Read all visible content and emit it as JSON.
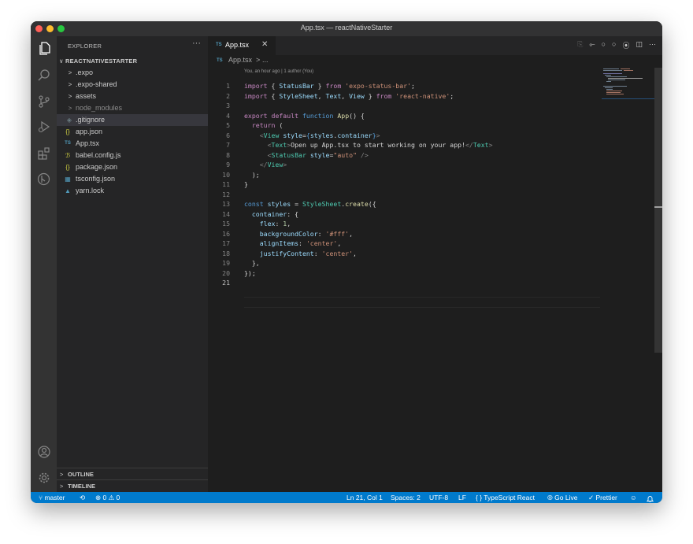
{
  "window": {
    "title": "App.tsx — reactNativeStarter"
  },
  "colors": {
    "accent": "#007acc",
    "editor_bg": "#1e1e1e",
    "sidebar_bg": "#252526",
    "activity_bg": "#333333"
  },
  "activity_bar": {
    "top": [
      "files-icon",
      "search-icon",
      "source-control-icon",
      "run-debug-icon",
      "extensions-icon",
      "gitlens-icon"
    ],
    "bottom": [
      "account-icon",
      "settings-gear-icon"
    ]
  },
  "sidebar": {
    "header": "EXPLORER",
    "more": "···",
    "section": "REACTNATIVESTARTER",
    "items": [
      {
        "icon": ">",
        "label": ".expo"
      },
      {
        "icon": ">",
        "label": ".expo-shared"
      },
      {
        "icon": ">",
        "label": "assets"
      },
      {
        "icon": ">",
        "label": "node_modules"
      },
      {
        "icon": "◈",
        "label": ".gitignore"
      },
      {
        "icon": "{}",
        "label": "app.json"
      },
      {
        "icon": "TS",
        "label": "App.tsx"
      },
      {
        "icon": "ℬ",
        "label": "babel.config.js"
      },
      {
        "icon": "{}",
        "label": "package.json"
      },
      {
        "icon": "▦",
        "label": "tsconfig.json"
      },
      {
        "icon": "▲",
        "label": "yarn.lock"
      }
    ],
    "outline": "OUTLINE",
    "timeline": "TIMELINE"
  },
  "tab": {
    "lang": "TS",
    "name": "App.tsx",
    "close": "✕"
  },
  "tab_actions": [
    "⎘",
    "⟜",
    "○",
    "○",
    "⦿",
    "◫",
    "···"
  ],
  "breadcrumb": {
    "lang": "TS",
    "file": "App.tsx",
    "sep": ">",
    "rest": "..."
  },
  "editor": {
    "blame": "You, an hour ago | 1 author (You)",
    "current_line": 21,
    "lines": [
      "1",
      "2",
      "3",
      "4",
      "5",
      "6",
      "7",
      "8",
      "9",
      "10",
      "11",
      "12",
      "13",
      "14",
      "15",
      "16",
      "17",
      "18",
      "19",
      "20",
      "21"
    ],
    "code": {
      "l1": [
        "import",
        " { ",
        "StatusBar",
        " } ",
        "from",
        " ",
        "'expo-status-bar'",
        ";"
      ],
      "l2": [
        "import",
        " { ",
        "StyleSheet",
        ", ",
        "Text",
        ", ",
        "View",
        " } ",
        "from",
        " ",
        "'react-native'",
        ";"
      ],
      "l4": [
        "export",
        " ",
        "default",
        " ",
        "function",
        " ",
        "App",
        "() {"
      ],
      "l5": [
        "  ",
        "return",
        " ("
      ],
      "l6": [
        "    <",
        "View",
        " ",
        "style",
        "=",
        "{",
        "styles",
        ".",
        "container",
        "}",
        ">"
      ],
      "l7": [
        "      <",
        "Text",
        ">",
        "Open up App.tsx to start working on your app!",
        "</",
        "Text",
        ">"
      ],
      "l8": [
        "      <",
        "StatusBar",
        " ",
        "style",
        "=",
        "\"auto\"",
        " />"
      ],
      "l9": [
        "    </",
        "View",
        ">"
      ],
      "l10": [
        "  );"
      ],
      "l11": [
        "}"
      ],
      "l13": [
        "const",
        " ",
        "styles",
        " = ",
        "StyleSheet",
        ".",
        "create",
        "({"
      ],
      "l14": [
        "  ",
        "container",
        ": {"
      ],
      "l15": [
        "    ",
        "flex",
        ": ",
        "1",
        ","
      ],
      "l16": [
        "    ",
        "backgroundColor",
        ": ",
        "'#fff'",
        ","
      ],
      "l17": [
        "    ",
        "alignItems",
        ": ",
        "'center'",
        ","
      ],
      "l18": [
        "    ",
        "justifyContent",
        ": ",
        "'center'",
        ","
      ],
      "l19": [
        "  },"
      ],
      "l20": [
        "});"
      ]
    }
  },
  "status": {
    "branch": "master",
    "sync": "⟲",
    "problems": "⊗ 0 ⚠ 0",
    "position": "Ln 21, Col 1",
    "spaces": "Spaces: 2",
    "encoding": "UTF-8",
    "eol": "LF",
    "language": "{ } TypeScript React",
    "golive": "⦾ Go Live",
    "prettier": "✓ Prettier",
    "feedback": "☺",
    "bell": "🔔"
  }
}
